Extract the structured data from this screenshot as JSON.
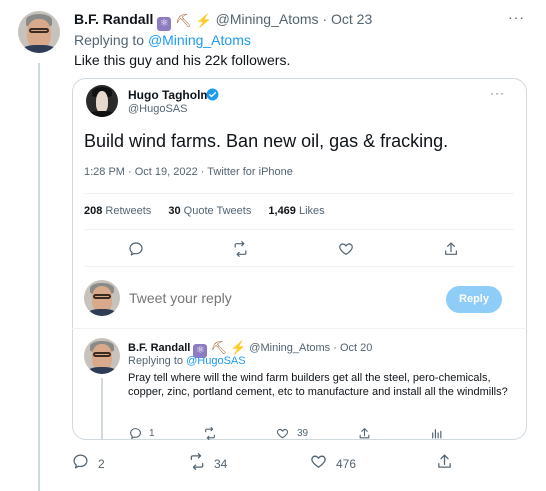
{
  "top_tweet": {
    "display_name": "B.F. Randall",
    "handle": "@Mining_Atoms",
    "date": "Oct 23",
    "replying_prefix": "Replying to",
    "replying_to": "@Mining_Atoms",
    "text": "Like this guy and his 22k followers.",
    "more": "···",
    "actions": {
      "replies": "2",
      "retweets": "34",
      "likes": "476"
    }
  },
  "quoted_tweet": {
    "display_name": "Hugo Tagholm",
    "handle": "@HugoSAS",
    "text": "Build wind farms. Ban new oil, gas & fracking.",
    "meta": "1:28 PM · Oct 19, 2022 · Twitter for iPhone",
    "more": "···",
    "stats": {
      "retweets_count": "208",
      "retweets_label": "Retweets",
      "quotes_count": "30",
      "quotes_label": "Quote Tweets",
      "likes_count": "1,469",
      "likes_label": "Likes"
    }
  },
  "reply_box": {
    "placeholder": "Tweet your reply",
    "button_label": "Reply"
  },
  "inner_reply": {
    "display_name": "B.F. Randall",
    "handle": "@Mining_Atoms",
    "date": "Oct 20",
    "replying_prefix": "Replying to",
    "replying_to": "@HugoSAS",
    "text": "Pray tell where will the wind farm builders get all the steel, pero-chemicals, copper, zinc, portland cement, etc to manufacture and install all the windmills?",
    "actions": {
      "replies": "1",
      "likes": "39"
    }
  },
  "emoji": {
    "atom": "⚛",
    "pick": "⛏",
    "bolt": "⚡"
  },
  "colors": {
    "accent": "#1d9bf0",
    "muted": "#536471",
    "reply_button": "#8ecdf7",
    "border": "#cfd9de"
  },
  "icons": [
    "reply-icon",
    "retweet-icon",
    "like-icon",
    "share-icon",
    "analytics-icon",
    "verified-icon",
    "more-icon"
  ]
}
